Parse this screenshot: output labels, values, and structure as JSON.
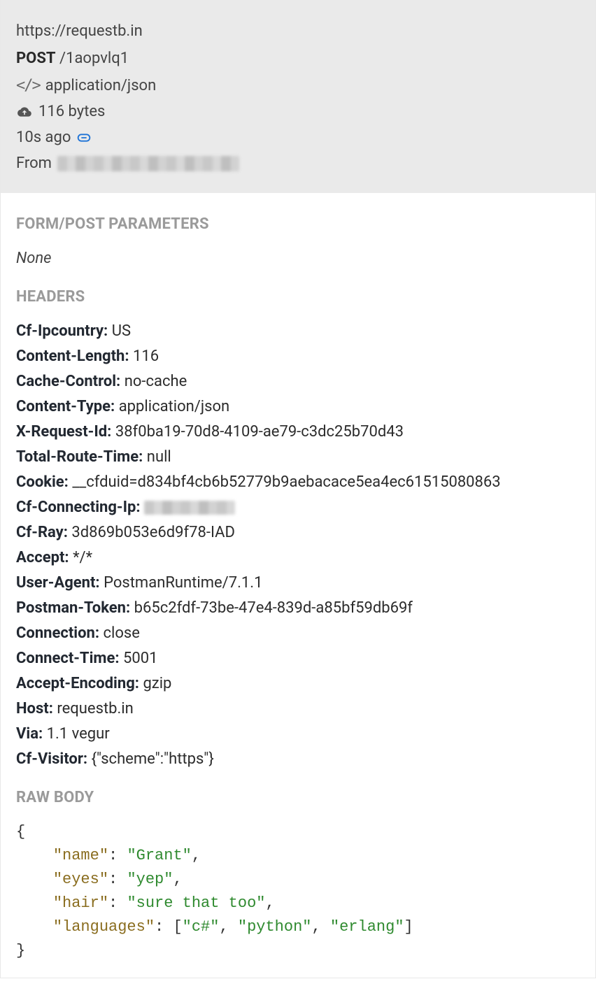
{
  "request": {
    "base_url": "https://requestb.in",
    "method": "POST",
    "path": "/1aopvlq1",
    "content_type": "application/json",
    "size_text": "116 bytes",
    "time_ago": "10s ago",
    "from_label": "From"
  },
  "sections": {
    "form_params_title": "FORM/POST PARAMETERS",
    "form_params_none": "None",
    "headers_title": "HEADERS",
    "raw_body_title": "RAW BODY"
  },
  "headers": [
    {
      "key": "Cf-Ipcountry:",
      "value": "US"
    },
    {
      "key": "Content-Length:",
      "value": "116"
    },
    {
      "key": "Cache-Control:",
      "value": "no-cache"
    },
    {
      "key": "Content-Type:",
      "value": "application/json"
    },
    {
      "key": "X-Request-Id:",
      "value": "38f0ba19-70d8-4109-ae79-c3dc25b70d43"
    },
    {
      "key": "Total-Route-Time:",
      "value": "null"
    },
    {
      "key": "Cookie:",
      "value": "__cfduid=d834bf4cb6b52779b9aebacace5ea4ec61515080863"
    },
    {
      "key": "Cf-Connecting-Ip:",
      "value": "[redacted]",
      "redacted": true
    },
    {
      "key": "Cf-Ray:",
      "value": "3d869b053e6d9f78-IAD"
    },
    {
      "key": "Accept:",
      "value": "*/*"
    },
    {
      "key": "User-Agent:",
      "value": "PostmanRuntime/7.1.1"
    },
    {
      "key": "Postman-Token:",
      "value": "b65c2fdf-73be-47e4-839d-a85bf59db69f"
    },
    {
      "key": "Connection:",
      "value": "close"
    },
    {
      "key": "Connect-Time:",
      "value": "5001"
    },
    {
      "key": "Accept-Encoding:",
      "value": "gzip"
    },
    {
      "key": "Host:",
      "value": "requestb.in"
    },
    {
      "key": "Via:",
      "value": "1.1 vegur"
    },
    {
      "key": "Cf-Visitor:",
      "value": "{\"scheme\":\"https\"}"
    }
  ],
  "raw_body": {
    "lines": [
      {
        "type": "brace",
        "text": "{"
      },
      {
        "type": "kv",
        "indent": 1,
        "key": "\"name\"",
        "value": "\"Grant\"",
        "comma": true
      },
      {
        "type": "kv",
        "indent": 1,
        "key": "\"eyes\"",
        "value": "\"yep\"",
        "comma": true
      },
      {
        "type": "kv",
        "indent": 1,
        "key": "\"hair\"",
        "value": "\"sure that too\"",
        "comma": true
      },
      {
        "type": "karr",
        "indent": 1,
        "key": "\"languages\"",
        "values": [
          "\"c#\"",
          "\"python\"",
          "\"erlang\""
        ]
      },
      {
        "type": "brace",
        "text": "}"
      }
    ]
  }
}
